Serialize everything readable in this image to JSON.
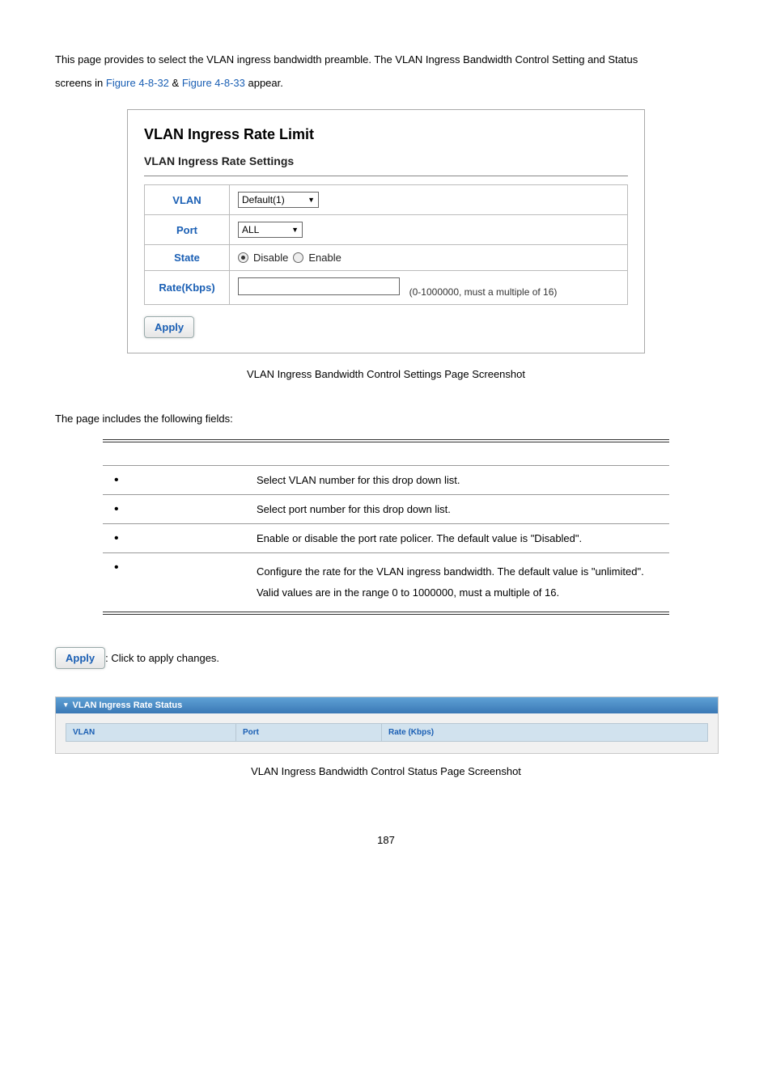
{
  "intro": {
    "line1_a": "This page provides to select the VLAN ingress bandwidth preamble. The VLAN Ingress Bandwidth Control Setting and Status",
    "line2_a": "screens in ",
    "link1": "Figure 4-8-32",
    "amp": " & ",
    "link2": "Figure 4-8-33",
    "line2_b": " appear."
  },
  "screenshot": {
    "main_title": "VLAN Ingress Rate Limit",
    "subtitle": "VLAN Ingress Rate Settings",
    "rows": {
      "vlan_label": "VLAN",
      "vlan_value": "Default(1)",
      "port_label": "Port",
      "port_value": "ALL",
      "state_label": "State",
      "state_disable": "Disable",
      "state_enable": "Enable",
      "rate_label": "Rate(Kbps)",
      "rate_hint": "(0-1000000, must a multiple of 16)"
    },
    "apply": "Apply"
  },
  "caption1": "VLAN Ingress Bandwidth Control Settings Page Screenshot",
  "fields_intro": "The page includes the following fields:",
  "fields": [
    {
      "desc": "Select VLAN number for this drop down list."
    },
    {
      "desc": "Select port number for this drop down list."
    },
    {
      "desc": "Enable or disable the port rate policer. The default value is \"Disabled\"."
    },
    {
      "desc": "Configure the rate for the VLAN ingress bandwidth. The default value is \"unlimited\". Valid values are in the range 0 to 1000000, must a multiple of 16."
    }
  ],
  "apply_note": ": Click to apply changes.",
  "status": {
    "bar_label": "VLAN Ingress Rate Status",
    "col_vlan": "VLAN",
    "col_port": "Port",
    "col_rate": "Rate (Kbps)"
  },
  "caption2": "VLAN Ingress Bandwidth Control Status Page Screenshot",
  "page_num": "187"
}
